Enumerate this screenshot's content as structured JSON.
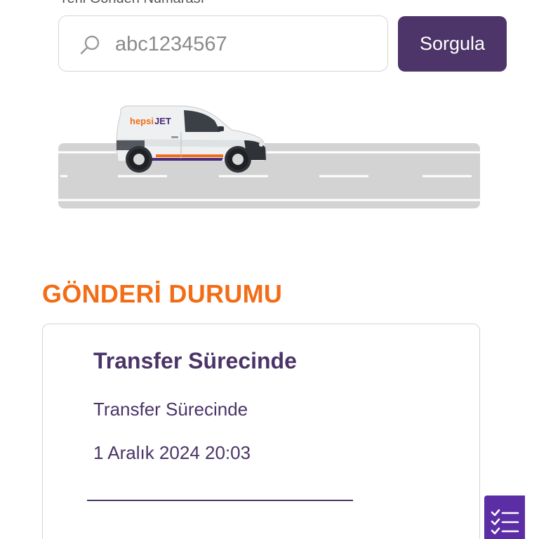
{
  "search": {
    "label": "Yeni Gönderi Numarası",
    "value": "abc1234567",
    "button_label": "Sorgula",
    "icon": "search-icon"
  },
  "van": {
    "brand_prefix": "hepsi",
    "brand_suffix": "JET"
  },
  "status_section": {
    "title": "GÖNDERİ DURUMU",
    "heading": "Transfer Sürecinde",
    "description": "Transfer Sürecinde",
    "date": "1 Aralık 2024 20:03"
  },
  "fab": {
    "icon": "checklist-icon"
  },
  "colors": {
    "primary": "#4d3569",
    "accent": "#f36c16",
    "fab": "#5b2ea6",
    "road": "#d3d3d3"
  }
}
